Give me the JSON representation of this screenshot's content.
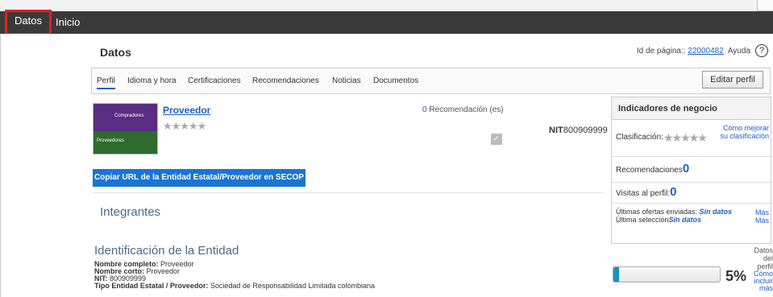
{
  "nav": {
    "active": "Datos",
    "inicio": "Inicio"
  },
  "header": {
    "title": "Datos",
    "page_id_label": "Id de página:: ",
    "page_id_value": "22000482",
    "help_label": "Ayuda",
    "help_icon": "?"
  },
  "tabs": [
    {
      "label": "Perfil"
    },
    {
      "label": "Idioma y hora"
    },
    {
      "label": "Certificaciones"
    },
    {
      "label": "Recomendaciones"
    },
    {
      "label": "Noticias"
    },
    {
      "label": "Documentos"
    }
  ],
  "edit_button": "Editar perfil",
  "logo": {
    "top_text": "Compradores",
    "bottom_text": "Proveedores"
  },
  "supplier": {
    "name": "Proveedor",
    "stars": "★★★★★",
    "recommendations_count": "0",
    "recommendations_label": " Recomendación (es)",
    "nit_label": "NIT",
    "nit_value": "800909999"
  },
  "copy_button": "Copiar URL de la Entidad Estatal/Proveedor en SECOP",
  "sections": {
    "members": "Integrantes",
    "identification": "Identificación de la Entidad"
  },
  "details": {
    "full_name_label": "Nombre completo:",
    "full_name_value": " Proveedor",
    "short_name_label": "Nombre corto:",
    "short_name_value": " Proveedor",
    "nit_label": "NIT:",
    "nit_value": " 800909999",
    "type_label": "Tipo Entidad Estatal / Proveedor:",
    "type_value": " Sociedad de Responsabilidad Limitada colombiana"
  },
  "indicators": {
    "title": "Indicadores de negocio",
    "classification_label": "Clasificación:",
    "stars": "★★★★★",
    "improve_link": "Cómo mejorar su clasificación",
    "recommendations_label": "Recomendaciones",
    "recommendations_value": "0",
    "visits_label": "Visitas al perfil:",
    "visits_value": "0",
    "last_offers_label": "Últimas ofertas enviadas: ",
    "last_offers_value": "Sin datos",
    "last_selection_label": "Última selección",
    "last_selection_value": "Sin datos",
    "more_link_1": "Más",
    "more_link_2": "Más",
    "profile_data_label": "Datos del perfil",
    "profile_progress": 5,
    "profile_percent": "5%",
    "include_more_link": "Cómo incluir más"
  }
}
